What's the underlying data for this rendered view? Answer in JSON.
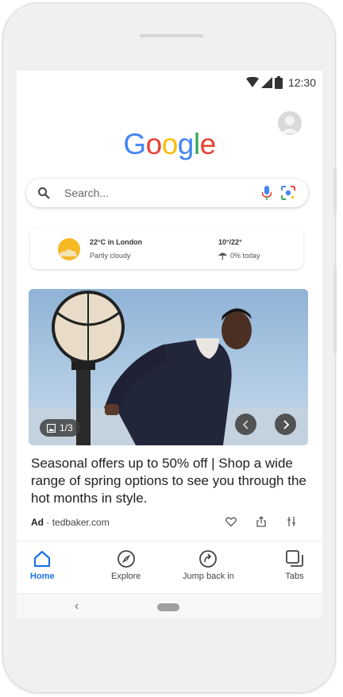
{
  "status_bar": {
    "time": "12:30"
  },
  "logo": {
    "letters": [
      {
        "ch": "G",
        "color": "#4285F4"
      },
      {
        "ch": "o",
        "color": "#EA4335"
      },
      {
        "ch": "o",
        "color": "#FBBC05"
      },
      {
        "ch": "g",
        "color": "#4285F4"
      },
      {
        "ch": "l",
        "color": "#34A853"
      },
      {
        "ch": "e",
        "color": "#EA4335"
      }
    ]
  },
  "search": {
    "placeholder": "Search..."
  },
  "weather": {
    "location_temp": "22°C in London",
    "condition": "Partly cloudy",
    "range": "10°/22°",
    "rain": "0% today"
  },
  "ad": {
    "image_counter": "1/3",
    "headline": "Seasonal offers up to 50% off | Shop a wide range of spring options to see you through the hot months in style.",
    "label": "Ad",
    "domain": "tedbaker.com"
  },
  "bottom_nav": {
    "home": "Home",
    "explore": "Explore",
    "jump_back": "Jump back in",
    "tabs": "Tabs"
  },
  "colors": {
    "accent": "#1a73e8"
  }
}
